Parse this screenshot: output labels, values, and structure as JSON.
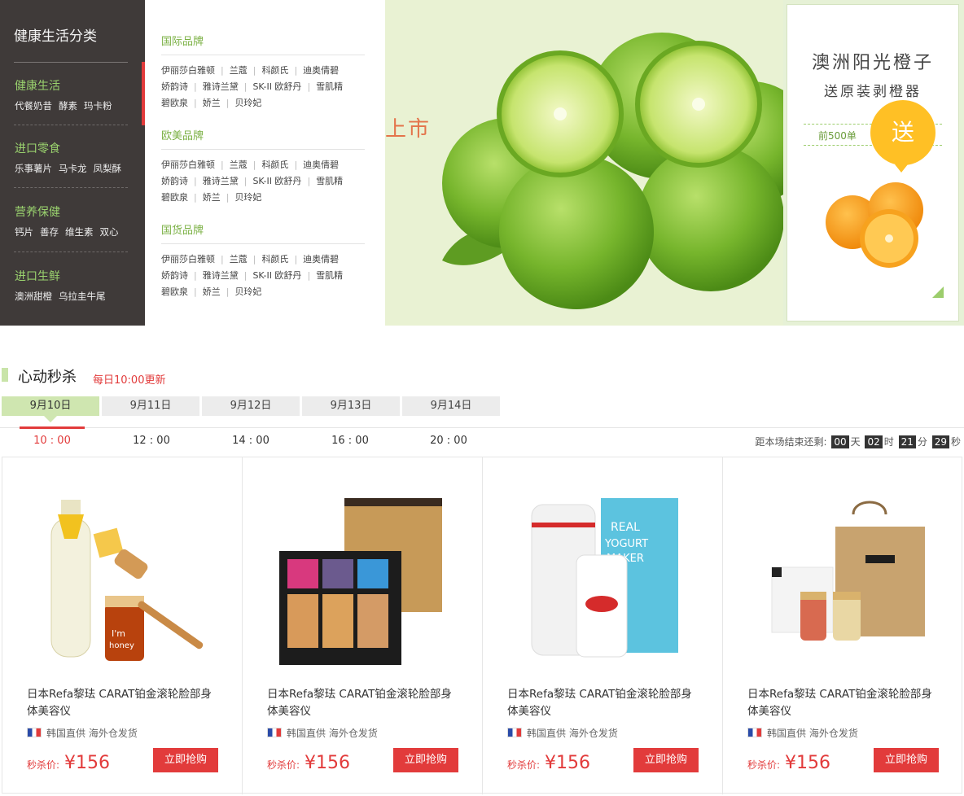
{
  "sidebar": {
    "title": "健康生活分类",
    "groups": [
      {
        "name": "健康生活",
        "links": [
          "代餐奶昔",
          "酵素",
          "玛卡粉"
        ]
      },
      {
        "name": "进口零食",
        "links": [
          "乐事薯片",
          "马卡龙",
          "凤梨酥"
        ]
      },
      {
        "name": "营养保健",
        "links": [
          "钙片",
          "善存",
          "维生素",
          "双心"
        ]
      },
      {
        "name": "进口生鲜",
        "links": [
          "澳洲甜橙",
          "乌拉圭牛尾"
        ]
      }
    ]
  },
  "brands": {
    "sections": [
      {
        "title": "国际品牌",
        "rows": [
          [
            "伊丽莎白雅顿",
            "兰蔻",
            "科颜氏",
            "迪奥倩碧"
          ],
          [
            "娇韵诗",
            "雅诗兰黛",
            "SK-II 欧舒丹",
            "雪肌精"
          ],
          [
            "碧欧泉",
            "娇兰",
            "贝玲妃"
          ]
        ]
      },
      {
        "title": "欧美品牌",
        "rows": [
          [
            "伊丽莎白雅顿",
            "兰蔻",
            "科颜氏",
            "迪奥倩碧"
          ],
          [
            "娇韵诗",
            "雅诗兰黛",
            "SK-II 欧舒丹",
            "雪肌精"
          ],
          [
            "碧欧泉",
            "娇兰",
            "贝玲妃"
          ]
        ]
      },
      {
        "title": "国货品牌",
        "rows": [
          [
            "伊丽莎白雅顿",
            "兰蔻",
            "科颜氏",
            "迪奥倩碧"
          ],
          [
            "娇韵诗",
            "雅诗兰黛",
            "SK-II 欧舒丹",
            "雪肌精"
          ],
          [
            "碧欧泉",
            "娇兰",
            "贝玲妃"
          ]
        ]
      }
    ]
  },
  "hero": {
    "text": "上市"
  },
  "promo": {
    "line1": "澳洲阳光橙子",
    "line2": "送原装剥橙器",
    "sub": "前500单",
    "badge": "送"
  },
  "flash": {
    "title": "心动秒杀",
    "subtitle": "每日10:00更新",
    "dates": [
      "9月10日",
      "9月11日",
      "9月12日",
      "9月13日",
      "9月14日"
    ],
    "times": [
      "10 : 00",
      "12 : 00",
      "14 : 00",
      "16 : 00",
      "20 : 00"
    ],
    "countdown": {
      "label": "距本场结束还剩:",
      "days": "00",
      "day_unit": "天",
      "hours": "02",
      "hour_unit": "时",
      "minutes": "21",
      "minute_unit": "分",
      "seconds": "29",
      "second_unit": "秒"
    }
  },
  "products": [
    {
      "name": "日本Refa黎珐 CARAT铂金滚轮脸部身体美容仪",
      "origin": "韩国直供 海外仓发货",
      "price_label": "秒杀价:",
      "price": "¥156",
      "button": "立即抢购"
    },
    {
      "name": "日本Refa黎珐 CARAT铂金滚轮脸部身体美容仪",
      "origin": "韩国直供 海外仓发货",
      "price_label": "秒杀价:",
      "price": "¥156",
      "button": "立即抢购"
    },
    {
      "name": "日本Refa黎珐 CARAT铂金滚轮脸部身体美容仪",
      "origin": "韩国直供 海外仓发货",
      "price_label": "秒杀价:",
      "price": "¥156",
      "button": "立即抢购"
    },
    {
      "name": "日本Refa黎珐 CARAT铂金滚轮脸部身体美容仪",
      "origin": "韩国直供 海外仓发货",
      "price_label": "秒杀价:",
      "price": "¥156",
      "button": "立即抢购"
    }
  ]
}
